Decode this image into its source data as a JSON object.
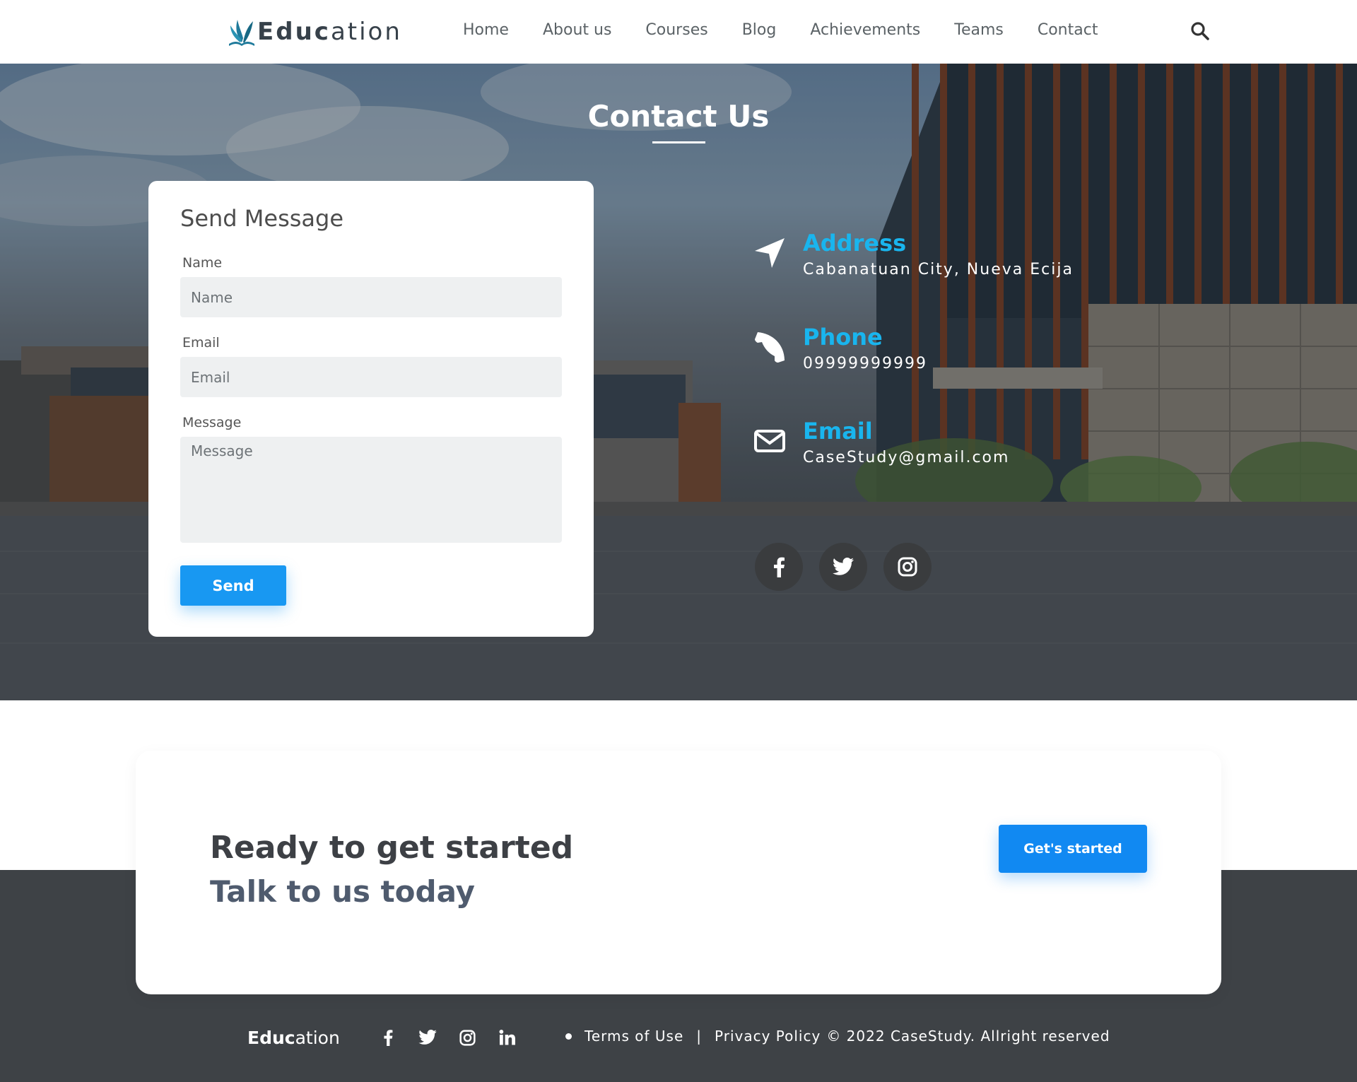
{
  "brand": {
    "bold": "Educ",
    "light": "ation"
  },
  "nav": {
    "items": [
      "Home",
      "About us",
      "Courses",
      "Blog",
      "Achievements",
      "Teams",
      "Contact"
    ]
  },
  "hero": {
    "title": "Contact Us"
  },
  "form": {
    "heading": "Send Message",
    "name_label": "Name",
    "name_placeholder": "Name",
    "email_label": "Email",
    "email_placeholder": "Email",
    "message_label": "Message",
    "message_placeholder": "Message",
    "send_label": "Send"
  },
  "contact": {
    "address_title": "Address",
    "address_value": "Cabanatuan City, Nueva Ecija",
    "phone_title": "Phone",
    "phone_value": "09999999999",
    "email_title": "Email",
    "email_value": "CaseStudy@gmail.com"
  },
  "social_icons": [
    "facebook-icon",
    "twitter-icon",
    "instagram-icon"
  ],
  "cta": {
    "title": "Ready to get started",
    "subtitle": "Talk to us today",
    "button_label": "Get's started"
  },
  "footer": {
    "terms": "Terms of Use",
    "separator": "|",
    "privacy": "Privacy Policy",
    "copyright": "© 2022 CaseStudy.  Allright reserved",
    "social_icons": [
      "facebook-icon",
      "twitter-icon",
      "instagram-icon",
      "linkedin-icon"
    ]
  },
  "colors": {
    "accent": "#1898f2",
    "info_title": "#19b5ee",
    "footer_bg": "#3e4246",
    "text_dark": "#3d4045"
  }
}
